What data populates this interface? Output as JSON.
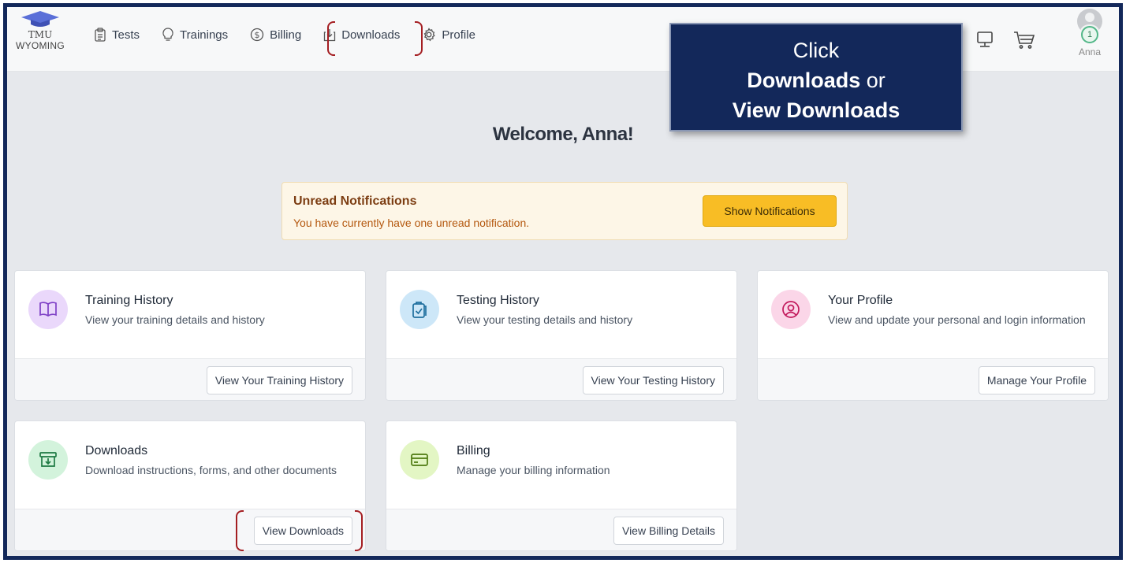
{
  "logo": {
    "line1": "TMU",
    "line2": "WYOMING"
  },
  "nav": {
    "tests": "Tests",
    "trainings": "Trainings",
    "billing": "Billing",
    "downloads": "Downloads",
    "profile": "Profile"
  },
  "user": {
    "name": "Anna",
    "badge_count": "1"
  },
  "callout": {
    "line1": "Click",
    "line2_bold": "Downloads",
    "line2_rest": " or",
    "line3": "View Downloads"
  },
  "welcome": "Welcome, Anna!",
  "notification": {
    "title": "Unread Notifications",
    "text": "You have currently have one unread notification.",
    "button": "Show Notifications"
  },
  "cards": [
    {
      "title": "Training History",
      "desc": "View your training details and history",
      "button": "View Your Training History",
      "icon": "book-icon",
      "color": "#ead8fb"
    },
    {
      "title": "Testing History",
      "desc": "View your testing details and history",
      "button": "View Your Testing History",
      "icon": "clipboard-check-icon",
      "color": "#cde7f8"
    },
    {
      "title": "Your Profile",
      "desc": "View and update your personal and login information",
      "button": "Manage Your Profile",
      "icon": "user-circle-icon",
      "color": "#fbd6e8"
    },
    {
      "title": "Downloads",
      "desc": "Download instructions, forms, and other documents",
      "button": "View Downloads",
      "icon": "archive-download-icon",
      "color": "#d3f3dc"
    },
    {
      "title": "Billing",
      "desc": "Manage your billing information",
      "button": "View Billing Details",
      "icon": "credit-card-icon",
      "color": "#e3f6c4"
    }
  ],
  "colors": {
    "frame": "#13285a",
    "highlight": "#a41e22",
    "accent_button": "#f8bd25"
  }
}
